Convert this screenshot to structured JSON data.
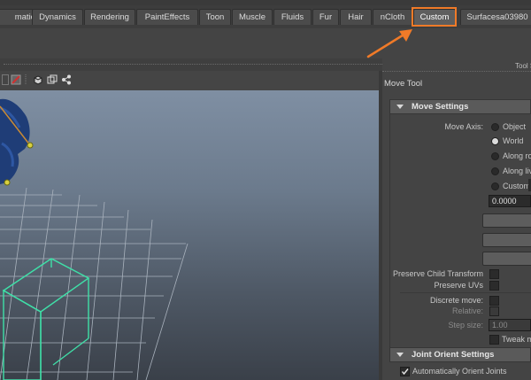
{
  "tabs": [
    {
      "label": "mation",
      "active": false
    },
    {
      "label": "Dynamics",
      "active": false
    },
    {
      "label": "Rendering",
      "active": false
    },
    {
      "label": "PaintEffects",
      "active": false
    },
    {
      "label": "Toon",
      "active": false
    },
    {
      "label": "Muscle",
      "active": false
    },
    {
      "label": "Fluids",
      "active": false
    },
    {
      "label": "Fur",
      "active": false
    },
    {
      "label": "Hair",
      "active": false
    },
    {
      "label": "nCloth",
      "active": false
    },
    {
      "label": "Custom",
      "active": true
    },
    {
      "label": "Surfacesa03980",
      "active": false
    }
  ],
  "annotation": {
    "color": "#f07a28",
    "highlight_target": "Custom"
  },
  "tool_settings": {
    "header_title": "Tool S",
    "tool_name": "Move Tool",
    "move_settings": {
      "section_title": "Move Settings",
      "move_axis_label": "Move Axis:",
      "axis_options": [
        {
          "label": "Object",
          "selected": false
        },
        {
          "label": "World",
          "selected": true
        },
        {
          "label": "Along ro",
          "selected": false
        },
        {
          "label": "Along liv",
          "selected": false
        },
        {
          "label": "Custom",
          "selected": false
        }
      ],
      "custom_value": "0.0000",
      "preserve_child_transform_label": "Preserve Child Transform",
      "preserve_uvs_label": "Preserve UVs",
      "discrete_move_label": "Discrete move:",
      "relative_label": "Relative:",
      "step_size_label": "Step size:",
      "step_size_value": "1.00",
      "tweak_label": "Tweak m"
    },
    "joint_orient_settings": {
      "section_title": "Joint Orient Settings",
      "auto_orient_label": "Automatically Orient Joints",
      "auto_orient_checked": true
    }
  },
  "colors": {
    "grid": "#a8b1bc",
    "cube": "#3fe0a8",
    "joint": "#d8d040",
    "model": "#1e3e7a"
  }
}
